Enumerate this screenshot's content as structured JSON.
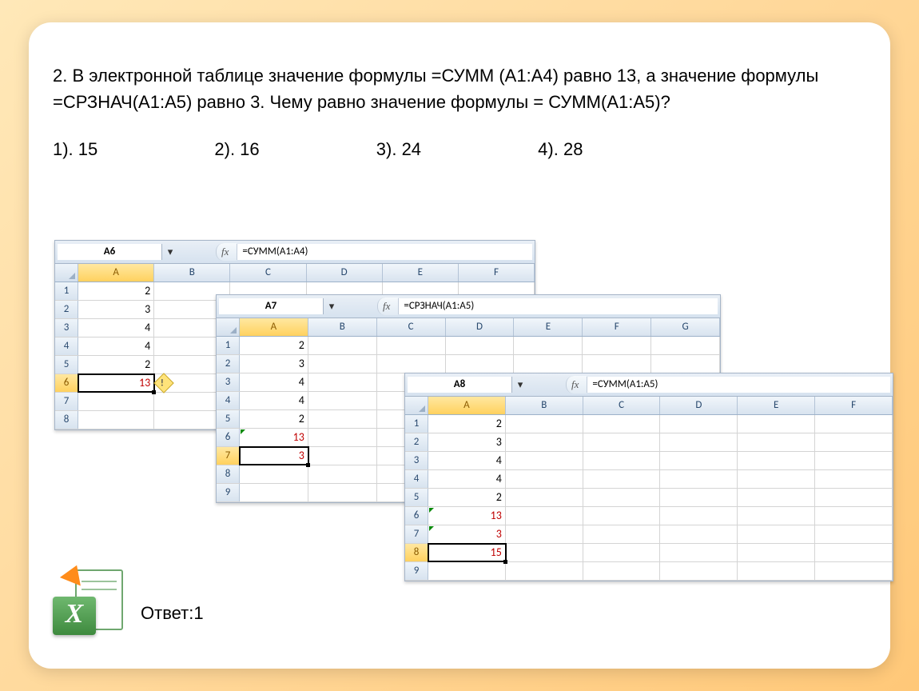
{
  "question": "2. В электронной таблице значение формулы  =СУММ (А1:А4) равно 13, а значение формулы =СРЗНАЧ(А1:А5) равно 3. Чему равно значение формулы = СУММ(А1:А5)?",
  "options": {
    "o1": "1). 15",
    "o2": "2). 16",
    "o3": "3). 24",
    "o4": "4). 28"
  },
  "answer_label": "Ответ:1",
  "fx_label": "fx",
  "logo_x": "X",
  "shots": {
    "s1": {
      "namebox": "A6",
      "formula": "=СУММ(A1:A4)",
      "cols": [
        "A",
        "B",
        "C",
        "D",
        "E",
        "F"
      ],
      "rows": {
        "r1": "2",
        "r2": "3",
        "r3": "4",
        "r4": "4",
        "r5": "2",
        "r6": "13"
      },
      "rowlabels": [
        "1",
        "2",
        "3",
        "4",
        "5",
        "6",
        "7",
        "8"
      ]
    },
    "s2": {
      "namebox": "A7",
      "formula": "=СРЗНАЧ(A1:A5)",
      "cols": [
        "A",
        "B",
        "C",
        "D",
        "E",
        "F",
        "G"
      ],
      "rows": {
        "r1": "2",
        "r2": "3",
        "r3": "4",
        "r4": "4",
        "r5": "2",
        "r6": "13",
        "r7": "3"
      },
      "rowlabels": [
        "1",
        "2",
        "3",
        "4",
        "5",
        "6",
        "7",
        "8",
        "9"
      ]
    },
    "s3": {
      "namebox": "A8",
      "formula": "=СУММ(A1:A5)",
      "cols": [
        "A",
        "B",
        "C",
        "D",
        "E",
        "F"
      ],
      "rows": {
        "r1": "2",
        "r2": "3",
        "r3": "4",
        "r4": "4",
        "r5": "2",
        "r6": "13",
        "r7": "3",
        "r8": "15"
      },
      "rowlabels": [
        "1",
        "2",
        "3",
        "4",
        "5",
        "6",
        "7",
        "8",
        "9"
      ]
    }
  }
}
